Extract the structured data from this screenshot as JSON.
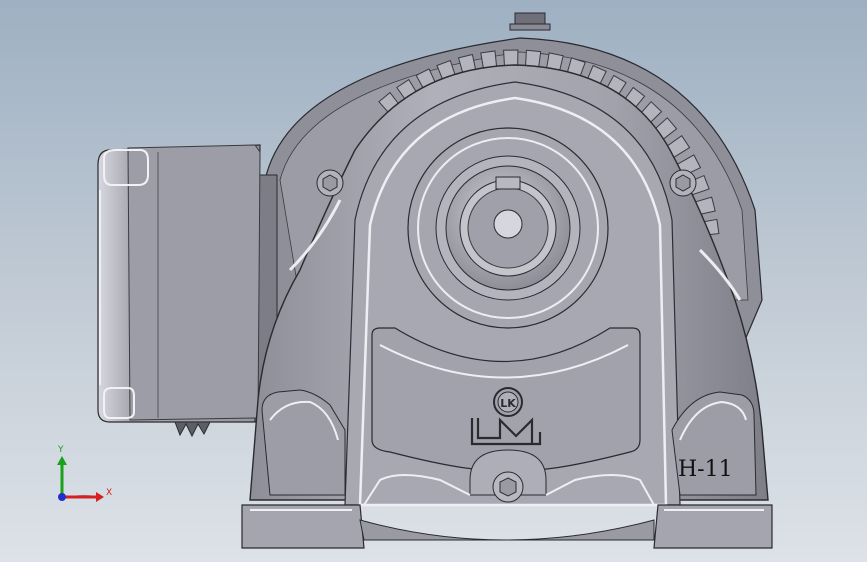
{
  "viewport": {
    "background_top": "#9eb0c2",
    "background_bottom": "#dde2e8"
  },
  "model": {
    "label": "H-11",
    "logo_text": "LK",
    "body_color": "#a3a3ad",
    "shadow_color": "#6b6b75",
    "highlight_color": "#ececf2",
    "outline_color": "#2a2a30"
  },
  "triad": {
    "x_label": "X",
    "y_label": "Y",
    "x_color": "#d62020",
    "y_color": "#1aa01a",
    "z_color": "#2030c8"
  }
}
